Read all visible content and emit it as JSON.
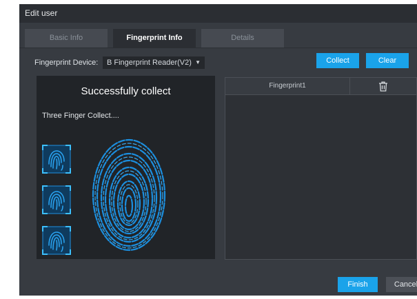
{
  "window": {
    "title": "Edit user"
  },
  "tabs": [
    {
      "label": "Basic Info",
      "active": false
    },
    {
      "label": "Fingerprint Info",
      "active": true
    },
    {
      "label": "Details",
      "active": false
    }
  ],
  "device": {
    "label": "Fingerprint Device:",
    "selected": "B Fingerprint Reader(V2)"
  },
  "buttons": {
    "collect": "Collect",
    "clear": "Clear",
    "finish": "Finish",
    "cancel": "Cancel"
  },
  "preview": {
    "status": "Successfully collect",
    "instruction": "Three Finger Collect...."
  },
  "fingerprint_table": {
    "column": "Fingerprint1",
    "rows": []
  },
  "colors": {
    "accent": "#1aa3ea",
    "fingerprint": "#1b8fe0"
  }
}
